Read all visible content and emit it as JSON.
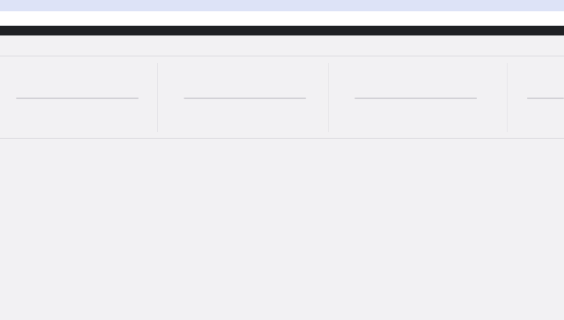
{
  "browser": {
    "tab_title": "",
    "right_text": ""
  },
  "address_bar": {
    "url": "",
    "links": [
      "",
      "",
      ""
    ]
  },
  "nav": {
    "brand": "",
    "right": ""
  },
  "sub_header": {
    "breadcrumb": "",
    "right_meta": ""
  },
  "panels": [
    {
      "label": ""
    },
    {
      "label": ""
    },
    {
      "label": ""
    },
    {
      "label": ""
    }
  ],
  "footer": {
    "left": "",
    "right": ""
  },
  "colors": {
    "background": "#f2f1f3",
    "top_strip": "#dde3f7",
    "nav_bar": "#1f2124",
    "address_bar": "#ffffff",
    "panel_rule": "#d3d2d7"
  }
}
